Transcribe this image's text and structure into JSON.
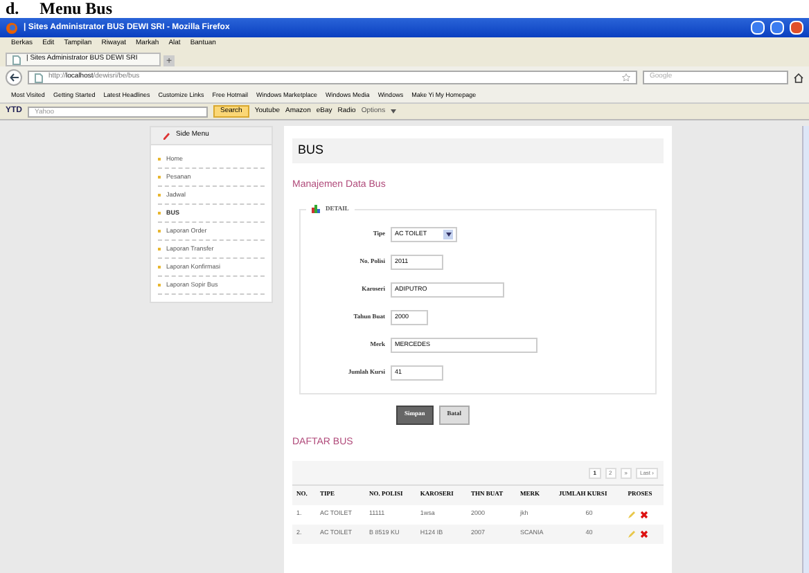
{
  "caption": "d.     Menu Bus",
  "window": {
    "title": "| Sites Administrator BUS DEWI SRI - Mozilla Firefox"
  },
  "menu": [
    "Berkas",
    "Edit",
    "Tampilan",
    "Riwayat",
    "Markah",
    "Alat",
    "Bantuan"
  ],
  "tabs": [
    {
      "label": "| Sites Administrator BUS DEWI SRI",
      "selected": true
    }
  ],
  "new_tab": "+",
  "address": {
    "prefix": "http://",
    "host": "localhost",
    "path": "/dewisri/be/bus"
  },
  "search": {
    "placeholder": "Google"
  },
  "bookmarks": [
    "Most Visited",
    "Getting Started",
    "Latest Headlines",
    "Customize Links",
    "Free Hotmail",
    "Windows Marketplace",
    "Windows Media",
    "Windows",
    "Make Yi My Homepage"
  ],
  "toolbar": {
    "logo": "YTD",
    "search_placeholder": "Yahoo",
    "search_button": "Search",
    "links": [
      "Youtube",
      "Amazon",
      "eBay",
      "Radio"
    ],
    "options": "Options"
  },
  "side_menu": {
    "title": "Side Menu",
    "items": [
      {
        "label": "Home",
        "selected": false
      },
      {
        "label": "Pesanan",
        "selected": false
      },
      {
        "label": "Jadwal",
        "selected": false
      },
      {
        "label": "BUS",
        "selected": true
      },
      {
        "label": "Laporan Order",
        "selected": false
      },
      {
        "label": "Laporan Transfer",
        "selected": false
      },
      {
        "label": "Laporan Konfirmasi",
        "selected": false
      },
      {
        "label": "Laporan Sopir Bus",
        "selected": false
      }
    ]
  },
  "page_title": "BUS",
  "section_title": "Manajemen Data Bus",
  "detail": {
    "legend": "DETAIL",
    "fields": [
      {
        "label": "Tipe",
        "kind": "select",
        "value": "AC TOILET"
      },
      {
        "label": "No. Polisi",
        "kind": "short",
        "value": "2011"
      },
      {
        "label": "Karoseri",
        "kind": "long",
        "value": "ADIPUTRO"
      },
      {
        "label": "Tahun Buat",
        "kind": "tiny",
        "value": "2000"
      },
      {
        "label": "Merk",
        "kind": "wide",
        "value": "MERCEDES"
      },
      {
        "label": "Jumlah Kursi",
        "kind": "short",
        "value": "41"
      }
    ]
  },
  "buttons": [
    {
      "label": "Simpan",
      "kind": "primary"
    },
    {
      "label": "Batal",
      "kind": "secondary"
    }
  ],
  "list_title": "DAFTAR BUS",
  "pagination": [
    {
      "label": "1",
      "selected": true
    },
    {
      "label": "2",
      "selected": false
    },
    {
      "label": "»",
      "selected": false
    },
    {
      "label": "Last ›",
      "selected": false
    }
  ],
  "table": {
    "columns": [
      "NO.",
      "TIPE",
      "NO. POLISI",
      "KAROSERI",
      "THN BUAT",
      "MERK",
      "JUMLAH KURSI",
      "PROSES"
    ],
    "rows": [
      [
        "1.",
        "AC TOILET",
        "11111",
        "1wsa",
        "2000",
        "jkh",
        "60"
      ],
      [
        "2.",
        "AC TOILET",
        "B 8519 KU",
        "H124 IB",
        "2007",
        "SCANIA",
        "40"
      ]
    ]
  }
}
